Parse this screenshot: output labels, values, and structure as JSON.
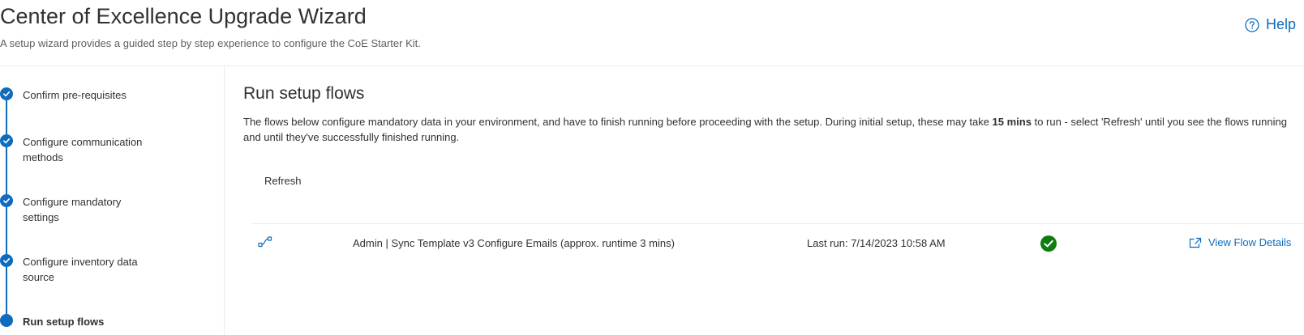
{
  "header": {
    "title": "Center of Excellence Upgrade Wizard",
    "subtitle": "A setup wizard provides a guided step by step experience to configure the CoE Starter Kit.",
    "help_label": "Help"
  },
  "steps": [
    {
      "label": "Confirm pre-requisites",
      "status": "complete",
      "icon": "checkmark-icon"
    },
    {
      "label": "Configure communication methods",
      "status": "complete",
      "icon": "checkmark-icon"
    },
    {
      "label": "Configure mandatory settings",
      "status": "complete",
      "icon": "checkmark-icon"
    },
    {
      "label": "Configure inventory data source",
      "status": "complete",
      "icon": "checkmark-icon"
    },
    {
      "label": "Run setup flows",
      "status": "active",
      "icon": "filled-circle-icon"
    }
  ],
  "main": {
    "title": "Run setup flows",
    "description_before": "The flows below configure mandatory data in your environment, and have to finish running before proceeding with the setup. During initial setup, these may take ",
    "description_bold": "15 mins",
    "description_after": " to run - select 'Refresh' until you see the flows running and until they've successfully finished running.",
    "refresh_label": "Refresh",
    "flows": [
      {
        "icon": "flow-icon",
        "name": "Admin | Sync Template v3 Configure Emails (approx. runtime 3 mins)",
        "last_run": "Last run: 7/14/2023 10:58 AM",
        "status": "success",
        "status_icon": "success-check-icon",
        "link_label": "View Flow Details",
        "link_icon": "open-external-icon"
      }
    ]
  },
  "colors": {
    "accent": "#0f6cbd",
    "success": "#107c10",
    "text": "#323130",
    "muted": "#605e5c",
    "divider": "#edebe9"
  }
}
